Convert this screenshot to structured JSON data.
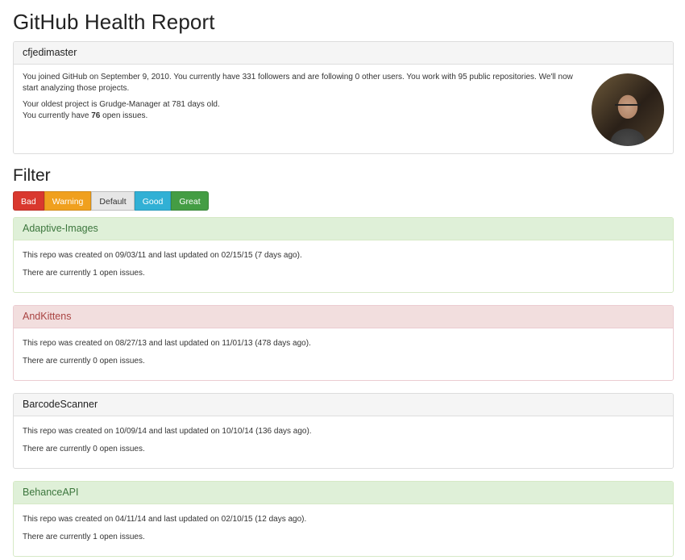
{
  "page": {
    "title": "GitHub Health Report"
  },
  "profile": {
    "username": "cfjedimaster",
    "intro": "You joined GitHub on September 9, 2010. You currently have 331 followers and are following 0 other users. You work with 95 public repositories. We'll now start analyzing those projects.",
    "oldest": "Your oldest project is Grudge-Manager at 781 days old.",
    "issues_prefix": "You currently have ",
    "issues_count": "76",
    "issues_suffix": " open issues."
  },
  "filter": {
    "title": "Filter",
    "buttons": [
      "Bad",
      "Warning",
      "Default",
      "Good",
      "Great"
    ],
    "colors": {
      "bad": "#d9382e",
      "warning": "#f0a01e",
      "default": "#e6e6e6",
      "good": "#31b0d5",
      "great": "#449d44"
    }
  },
  "repos": [
    {
      "name": "Adaptive-Images",
      "status": "good",
      "created": "This repo was created on 09/03/11 and last updated on 02/15/15 (7 days ago).",
      "issues": "There are currently 1 open issues."
    },
    {
      "name": "AndKittens",
      "status": "bad",
      "created": "This repo was created on 08/27/13 and last updated on 11/01/13 (478 days ago).",
      "issues": "There are currently 0 open issues."
    },
    {
      "name": "BarcodeScanner",
      "status": "default",
      "created": "This repo was created on 10/09/14 and last updated on 10/10/14 (136 days ago).",
      "issues": "There are currently 0 open issues."
    },
    {
      "name": "BehanceAPI",
      "status": "good",
      "created": "This repo was created on 04/11/14 and last updated on 02/10/15 (12 days ago).",
      "issues": "There are currently 1 open issues."
    }
  ]
}
